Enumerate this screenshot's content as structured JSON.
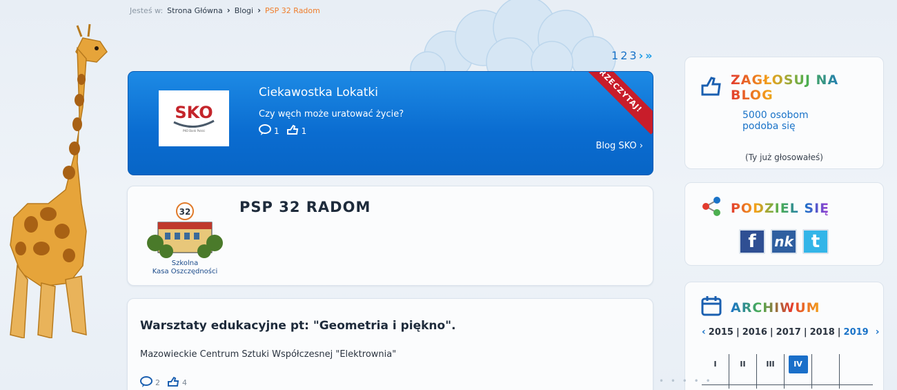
{
  "breadcrumb": {
    "prefix": "Jesteś w:",
    "home": "Strona Główna",
    "blogs": "Blogi",
    "current": "PSP 32 Radom"
  },
  "pager": {
    "pages": [
      "1",
      "2",
      "3"
    ]
  },
  "featured": {
    "logo_text": "SKO",
    "logo_sub": "PKO Bank Polski",
    "title": "Ciekawostka Lokatki",
    "description": "Czy węch może uratować życie?",
    "comments": "1",
    "likes": "1",
    "ribbon": "PRZECZYTAJ!",
    "blog_link": "Blog SKO"
  },
  "school": {
    "title": "PSP 32 RADOM",
    "logo_number": "32",
    "logo_line1": "Szkolna",
    "logo_line2": "Kasa Oszczędności"
  },
  "post": {
    "title": "Warsztaty edukacyjne pt: \"Geometria i piękno\".",
    "description": "Mazowieckie Centrum Sztuki Współczesnej \"Elektrownia\"",
    "comments": "2",
    "likes": "4"
  },
  "vote": {
    "heading": "ZAGŁOSUJ NA BLOG",
    "count": "5000 osobom podoba się",
    "voted": "(Ty już głosowałeś)"
  },
  "share": {
    "heading": "PODZIEL SIĘ",
    "facebook": "f",
    "nk": "nk",
    "twitter": "t"
  },
  "archive": {
    "heading": "ARCHIWUM",
    "years": [
      "2015",
      "2016",
      "2017",
      "2018",
      "2019"
    ],
    "active_year": "2019",
    "months": [
      "I",
      "II",
      "III",
      "IV"
    ],
    "current_month": "IV"
  },
  "colors": {
    "accent": "#1a73c8",
    "orange": "#ef7d2c",
    "ribbon": "#c81d2a"
  }
}
